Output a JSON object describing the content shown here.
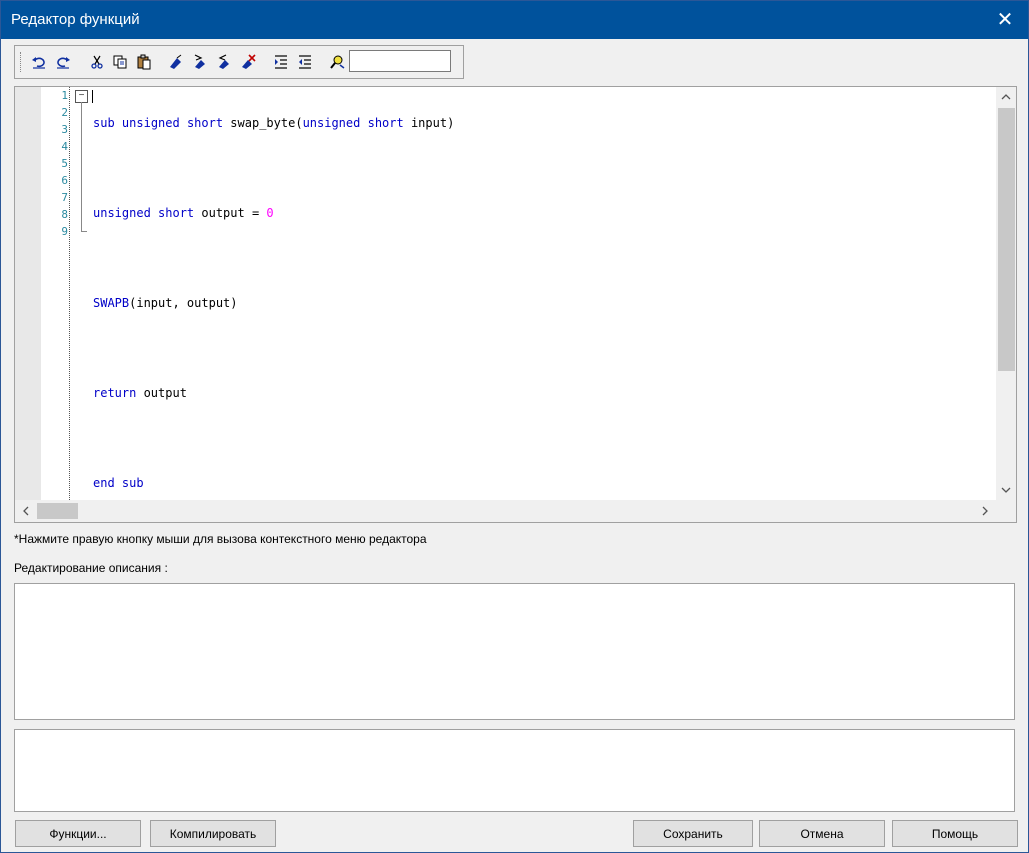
{
  "window": {
    "title": "Редактор функций",
    "close_glyph": "✕"
  },
  "toolbar": {
    "icons": [
      "undo-icon",
      "redo-icon",
      "cut-icon",
      "copy-icon",
      "paste-icon",
      "bookmark-toggle-icon",
      "bookmark-next-icon",
      "bookmark-prev-icon",
      "bookmark-clear-icon",
      "indent-icon",
      "outdent-icon",
      "find-icon"
    ],
    "search_value": ""
  },
  "editor": {
    "line_numbers": [
      "1",
      "2",
      "3",
      "4",
      "5",
      "6",
      "7",
      "8",
      "9"
    ],
    "fold_glyph": "−"
  },
  "hint_text": "*Нажмите правую кнопку мыши для вызова контекстного меню редактора",
  "description_label": "Редактирование описания :",
  "buttons": {
    "functions": "Функции...",
    "compile": "Компилировать",
    "save": "Сохранить",
    "cancel": "Отмена",
    "help": "Помощь"
  },
  "colors": {
    "titlebar": "#00529c",
    "keyword": "#0000c8",
    "number": "#ff00ff",
    "line_number": "#2a8aa0"
  }
}
